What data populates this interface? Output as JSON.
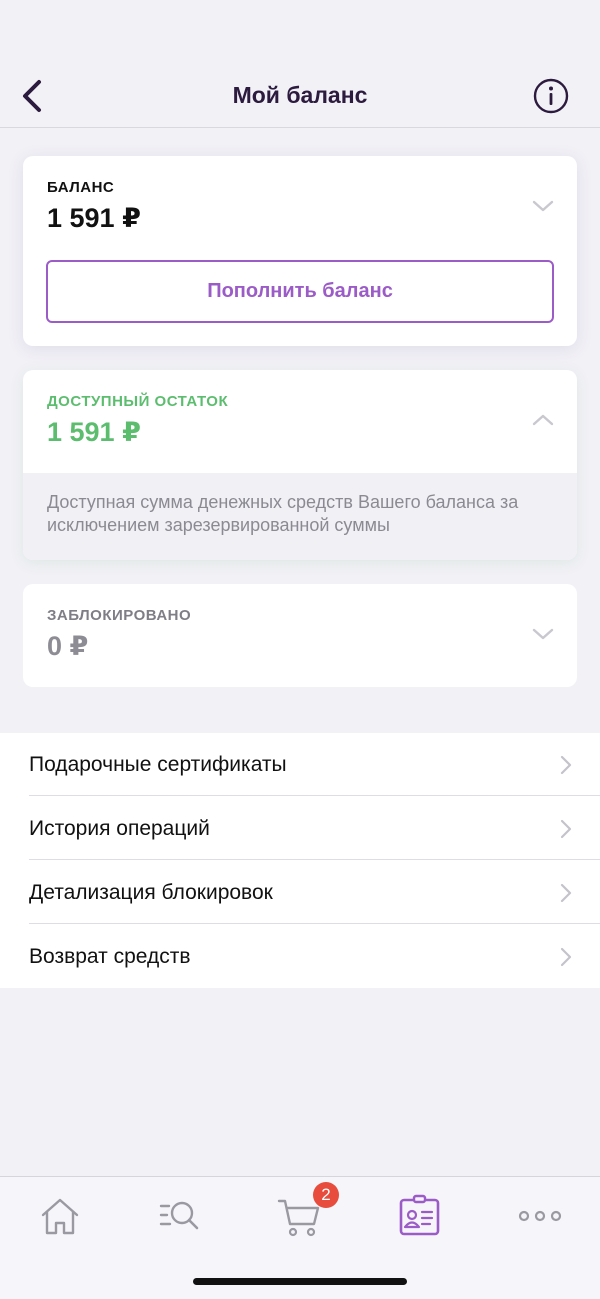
{
  "header": {
    "title": "Мой баланс",
    "back_icon": "chevron-left-icon",
    "info_icon": "info-circle-icon"
  },
  "balance": {
    "label": "БАЛАНС",
    "amount": "1 591 ₽",
    "topup_label": "Пополнить баланс",
    "expanded": false
  },
  "available": {
    "label": "ДОСТУПНЫЙ ОСТАТОК",
    "amount": "1 591 ₽",
    "description": "Доступная сумма денежных средств Вашего баланса за исключением зарезервированной суммы",
    "expanded": true
  },
  "blocked": {
    "label": "ЗАБЛОКИРОВАНО",
    "amount": "0 ₽",
    "expanded": false
  },
  "menu": {
    "items": [
      {
        "label": "Подарочные сертификаты"
      },
      {
        "label": "История операций"
      },
      {
        "label": "Детализация блокировок"
      },
      {
        "label": "Возврат средств"
      }
    ]
  },
  "tabbar": {
    "tabs": [
      "home-icon",
      "catalog-search-icon",
      "cart-icon",
      "profile-card-icon",
      "more-icon"
    ],
    "active": "profile-card-icon",
    "cart_badge": "2"
  },
  "colors": {
    "accent": "#9b5cc7",
    "title": "#2c1b3f",
    "available_green": "#5cbd6f",
    "badge_red": "#e74c3c",
    "background": "#f2f1f6"
  }
}
